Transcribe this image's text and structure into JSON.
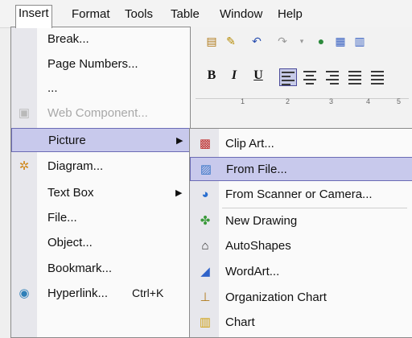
{
  "menubar": {
    "items": [
      "Insert",
      "Format",
      "Tools",
      "Table",
      "Window",
      "Help"
    ]
  },
  "toolbar": {
    "format_buttons": [
      "B",
      "I",
      "U"
    ],
    "ruler_numbers": [
      "1",
      "2",
      "3",
      "4",
      "5"
    ]
  },
  "insert_menu": {
    "items": [
      {
        "label": "Break..."
      },
      {
        "label": "Page Numbers..."
      },
      {
        "label": "..."
      },
      {
        "label": "Web Component...",
        "disabled": true
      },
      {
        "label": "Picture",
        "submenu": true
      },
      {
        "label": "Diagram..."
      },
      {
        "label": "Text Box",
        "submenu": true
      },
      {
        "label": "File..."
      },
      {
        "label": "Object..."
      },
      {
        "label": "Bookmark..."
      },
      {
        "label": "Hyperlink...",
        "shortcut": "Ctrl+K"
      }
    ]
  },
  "picture_submenu": {
    "items": [
      {
        "label": "Clip Art..."
      },
      {
        "label": "From File..."
      },
      {
        "label": "From Scanner or Camera..."
      },
      {
        "label": "New Drawing"
      },
      {
        "label": "AutoShapes"
      },
      {
        "label": "WordArt..."
      },
      {
        "label": "Organization Chart"
      },
      {
        "label": "Chart"
      }
    ]
  },
  "submenu_arrow": "▶"
}
